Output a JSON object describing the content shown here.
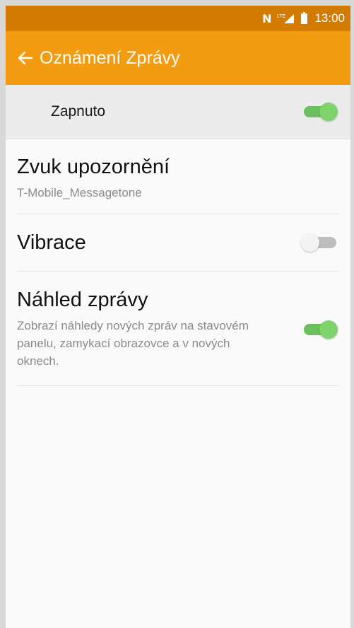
{
  "status_bar": {
    "nfc_icon": "N",
    "network_label": "LTE",
    "time": "13:00"
  },
  "app_bar": {
    "title": "Oznámení Zprávy",
    "back_icon": "arrow-left-icon"
  },
  "master_switch": {
    "label": "Zapnuto",
    "on": true
  },
  "settings": {
    "sound": {
      "title": "Zvuk upozornění",
      "subtitle": "T-Mobile_Messagetone"
    },
    "vibrate": {
      "title": "Vibrace",
      "on": false
    },
    "preview": {
      "title": "Náhled zprávy",
      "subtitle": "Zobrazí náhledy nových zpráv na stavovém panelu, zamykací obrazovce a v nových oknech.",
      "on": true
    }
  },
  "colors": {
    "status_bar": "#d37a00",
    "app_bar": "#f39c12",
    "toggle_on": "#7ed46b",
    "toggle_off": "#bdbdbd"
  }
}
